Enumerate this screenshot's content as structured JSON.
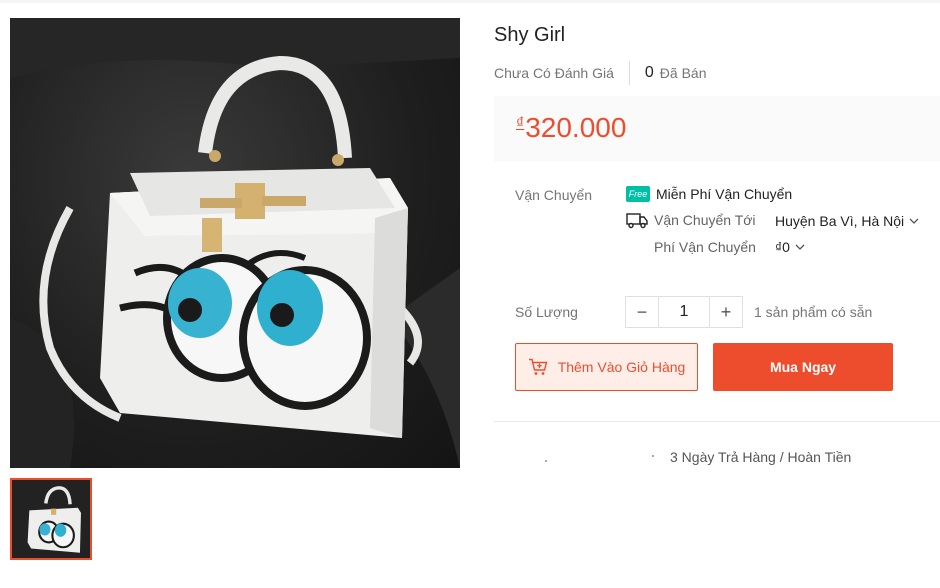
{
  "product": {
    "title": "Shy Girl",
    "rating_text": "Chưa Có Đánh Giá",
    "sold_count": "0",
    "sold_label": "Đã Bán",
    "currency": "₫",
    "price": "320.000"
  },
  "shipping": {
    "label": "Vận Chuyển",
    "free_badge": "Free",
    "free_text": "Miễn Phí Vận Chuyển",
    "ship_to_label": "Vận Chuyển Tới",
    "ship_to_value": "Huyện Ba Vì, Hà Nội",
    "fee_label": "Phí Vận Chuyển",
    "fee_value": "₫0"
  },
  "quantity": {
    "label": "Số Lượng",
    "value": "1",
    "minus": "−",
    "plus": "+",
    "stock_text": "1 sản phẩm có sẵn"
  },
  "actions": {
    "add_to_cart": "Thêm Vào Giỏ Hàng",
    "buy_now": "Mua Ngay"
  },
  "policy": {
    "return_text": "3 Ngày Trả Hàng / Hoàn Tiền"
  },
  "colors": {
    "accent": "#ee4d2d",
    "free_ship": "#00bfa5"
  },
  "icons": [
    "truck-icon",
    "cart-add-icon",
    "chevron-down-icon",
    "free-shipping-icon"
  ]
}
